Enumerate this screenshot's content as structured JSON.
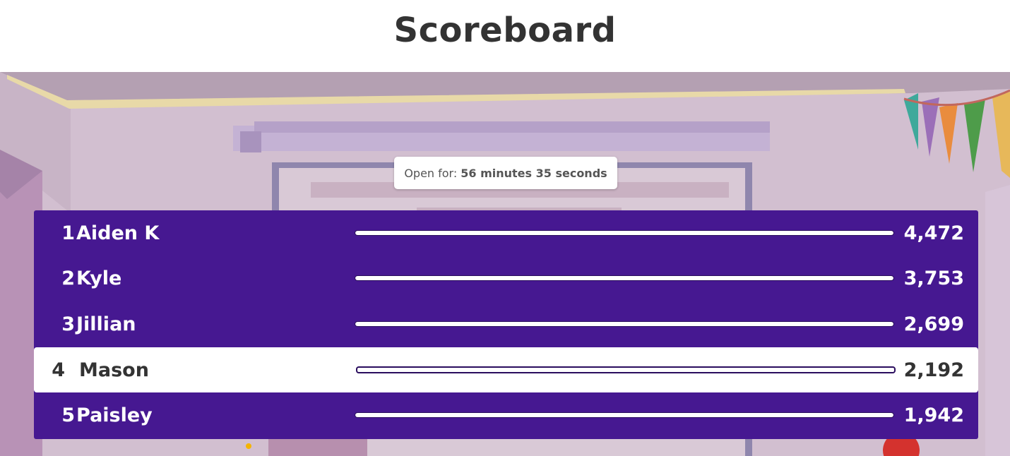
{
  "page": {
    "title": "Scoreboard"
  },
  "timer": {
    "label": "Open for:",
    "value": "56 minutes 35 seconds"
  },
  "leaderboard": {
    "rows": [
      {
        "rank": "1",
        "name": "Aiden K",
        "score": "4,472",
        "progress": 1.0,
        "highlighted": false
      },
      {
        "rank": "2",
        "name": "Kyle",
        "score": "3,753",
        "progress": 1.0,
        "highlighted": false
      },
      {
        "rank": "3",
        "name": "Jillian",
        "score": "2,699",
        "progress": 1.0,
        "highlighted": false
      },
      {
        "rank": "4",
        "name": "Mason",
        "score": "2,192",
        "progress": 1.0,
        "highlighted": true
      },
      {
        "rank": "5",
        "name": "Paisley",
        "score": "1,942",
        "progress": 1.0,
        "highlighted": false
      }
    ]
  },
  "colors": {
    "board": "#461891",
    "highlight_row": "#ffffff",
    "title": "#333333"
  }
}
